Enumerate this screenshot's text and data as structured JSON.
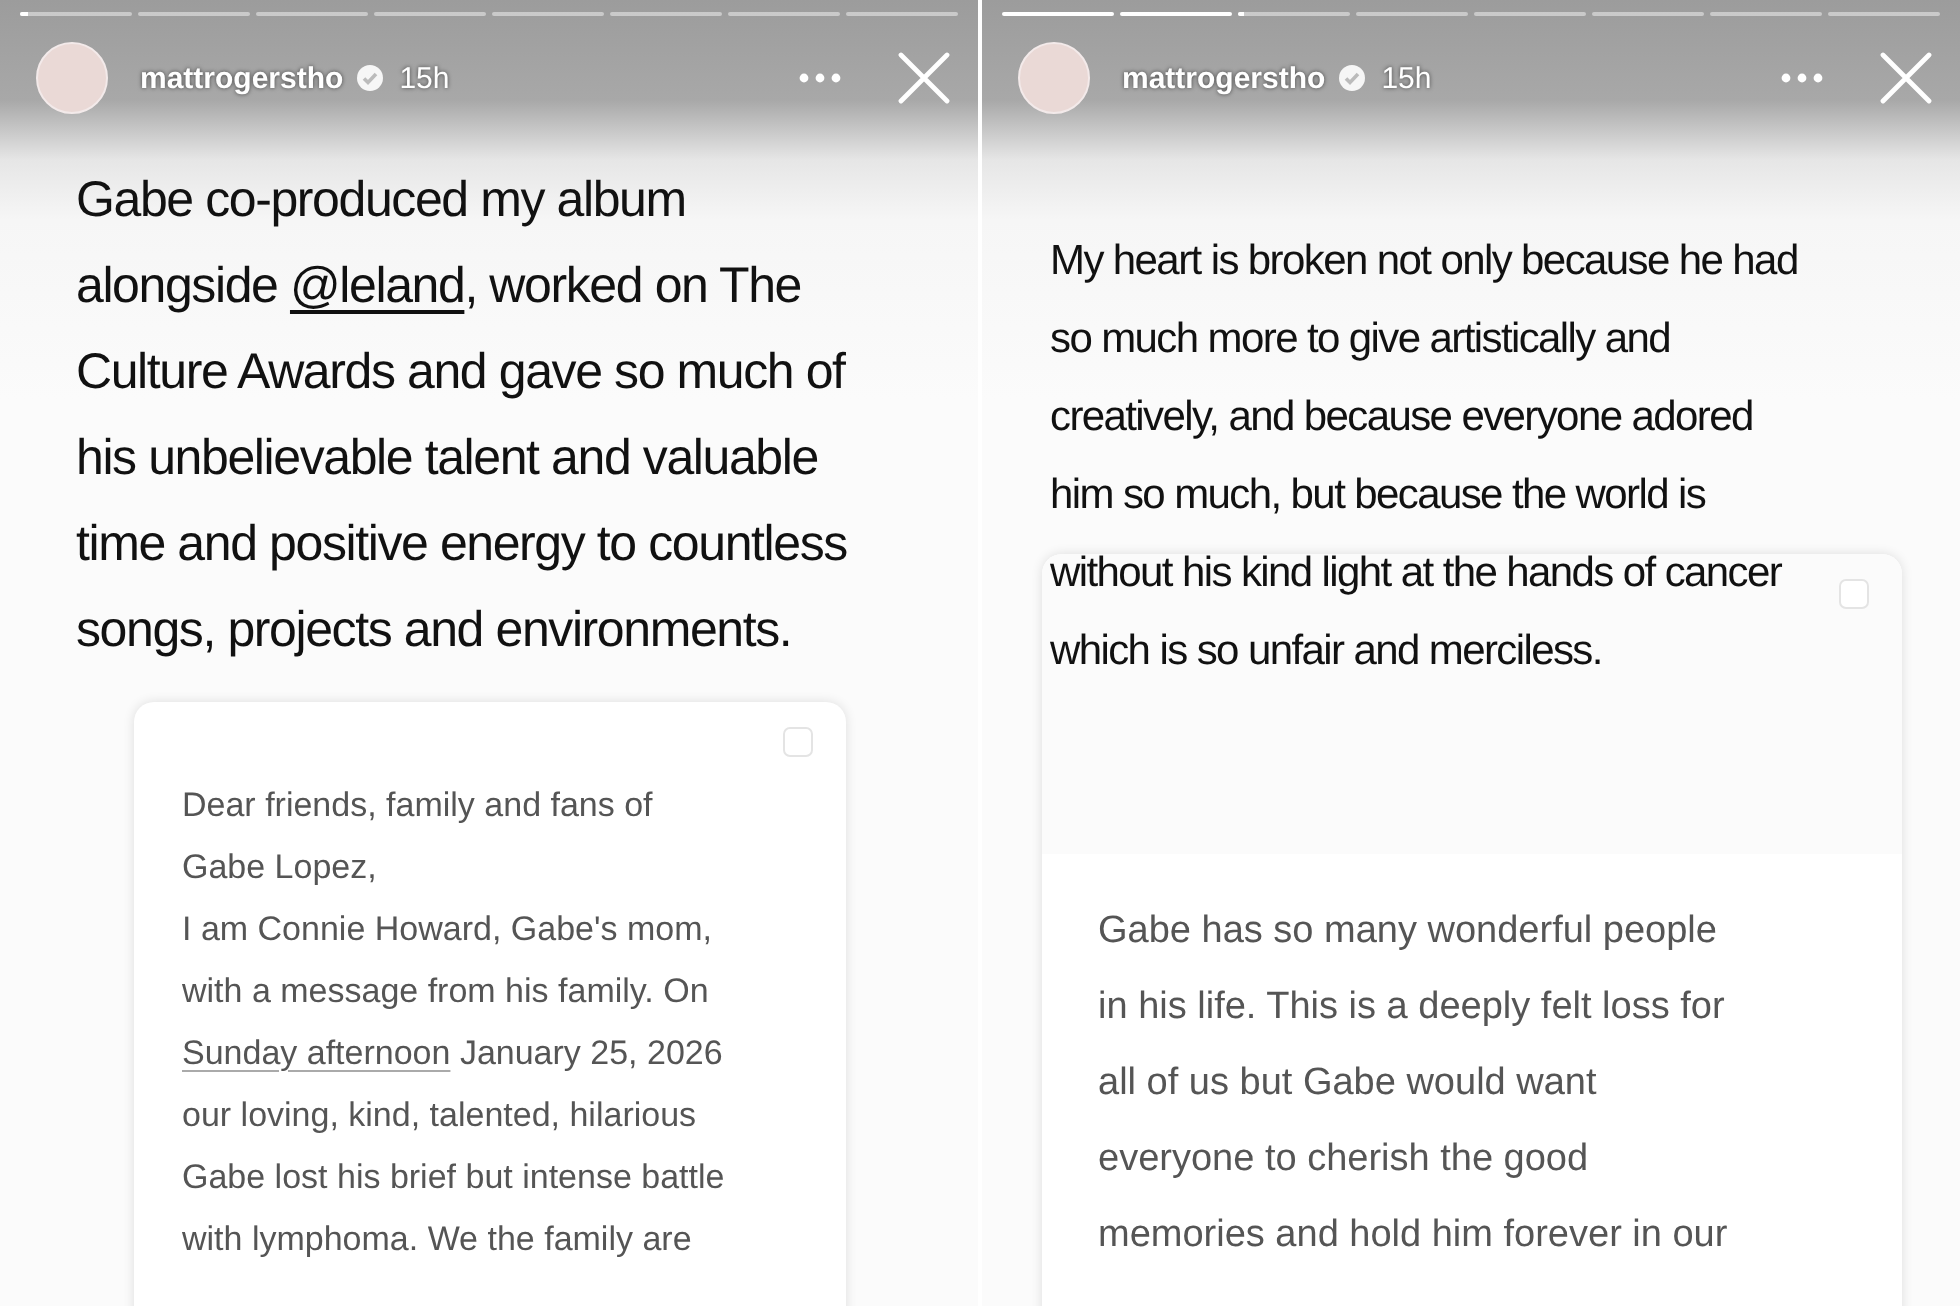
{
  "stories": [
    {
      "progress": [
        {
          "level": 0.08
        },
        {
          "level": 0
        },
        {
          "level": 0
        },
        {
          "level": 0
        },
        {
          "level": 0
        },
        {
          "level": 0
        },
        {
          "level": 0
        },
        {
          "level": 0
        }
      ],
      "header": {
        "username": "mattrogerstho",
        "verified": true,
        "time": "15h"
      },
      "caption": [
        {
          "kind": "text",
          "text": "Gabe co-produced my album\nalongside "
        },
        {
          "kind": "mention",
          "text": "@leland"
        },
        {
          "kind": "text",
          "text": ", worked on The\nCulture Awards and gave so much of\nhis unbelievable talent and valuable\ntime and positive energy to countless\nsongs, projects and environments."
        }
      ],
      "card": {
        "paragraph": [
          {
            "kind": "text",
            "text": "Dear friends, family and fans of\nGabe Lopez,\nI am Connie Howard, Gabe's mom,\nwith a message from his family. On\n"
          },
          {
            "kind": "link",
            "text": "Sunday afternoon"
          },
          {
            "kind": "text",
            "text": " January 25, 2026\nour loving, kind, talented, hilarious\nGabe lost his brief but intense battle\nwith lymphoma. We the family are"
          }
        ]
      }
    },
    {
      "progress": [
        {
          "level": 1
        },
        {
          "level": 1
        },
        {
          "level": 0.05
        },
        {
          "level": 0
        },
        {
          "level": 0
        },
        {
          "level": 0
        },
        {
          "level": 0
        },
        {
          "level": 0
        }
      ],
      "header": {
        "username": "mattrogerstho",
        "verified": true,
        "time": "15h"
      },
      "caption": [
        {
          "kind": "text",
          "text": "My heart is broken not only because he had\nso much more to give artistically and\ncreatively, and because everyone adored\nhim so much, but because the world is\nwithout his kind light at the hands of cancer\nwhich is so unfair and merciless."
        }
      ],
      "card": {
        "paragraph": [
          {
            "kind": "text",
            "text": "Gabe has so many wonderful people\nin his life. This is a deeply felt loss for\nall of us but Gabe would want\neveryone to cherish the good\nmemories and hold him forever in our"
          }
        ]
      }
    }
  ]
}
